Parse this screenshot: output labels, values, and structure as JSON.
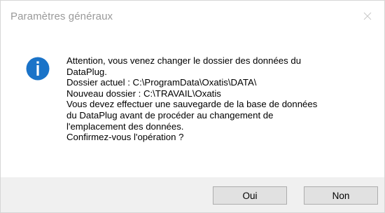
{
  "dialog": {
    "title": "Paramètres généraux",
    "close_icon": "close-icon",
    "icon": "information-icon",
    "message_lines": [
      "Attention, vous venez changer le dossier des données du",
      "DataPlug.",
      "Dossier actuel :  C:\\ProgramData\\Oxatis\\DATA\\",
      "Nouveau dossier : C:\\TRAVAIL\\Oxatis",
      "Vous devez effectuer une sauvegarde de la base de données",
      "du DataPlug avant de procéder au changement de",
      "l'emplacement des données.",
      "Confirmez-vous l'opération ?"
    ],
    "buttons": {
      "yes_label": "Oui",
      "no_label": "Non"
    },
    "colors": {
      "icon_blue": "#1a73c8",
      "footer_bg": "#f0f0f0",
      "button_bg": "#e1e1e1",
      "title_text": "#9a9a9a"
    }
  }
}
